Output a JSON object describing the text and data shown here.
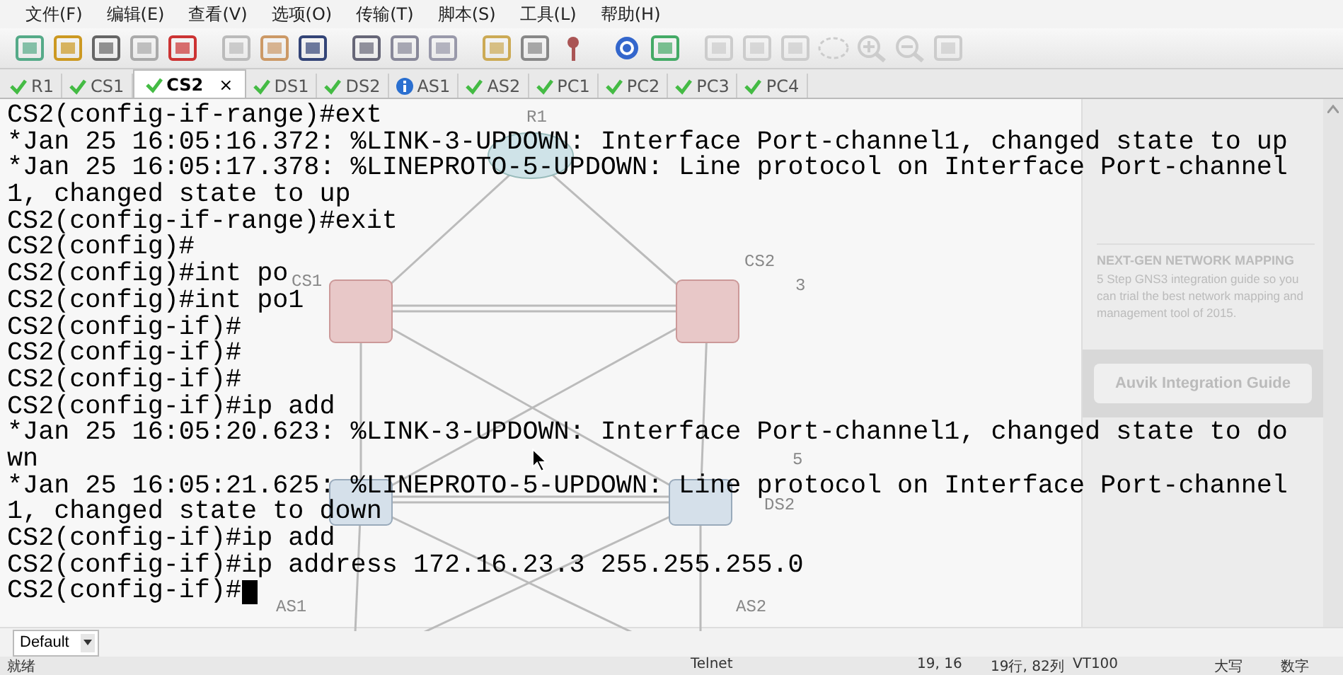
{
  "menu": [
    "文件(F)",
    "编辑(E)",
    "查看(V)",
    "选项(O)",
    "传输(T)",
    "脚本(S)",
    "工具(L)",
    "帮助(H)"
  ],
  "tabs": [
    {
      "label": "R1",
      "kind": "ok",
      "selected": false
    },
    {
      "label": "CS1",
      "kind": "ok",
      "selected": false
    },
    {
      "label": "CS2",
      "kind": "ok",
      "selected": true,
      "close": "×"
    },
    {
      "label": "DS1",
      "kind": "ok",
      "selected": false
    },
    {
      "label": "DS2",
      "kind": "ok",
      "selected": false
    },
    {
      "label": "AS1",
      "kind": "info",
      "selected": false
    },
    {
      "label": "AS2",
      "kind": "ok",
      "selected": false
    },
    {
      "label": "PC1",
      "kind": "ok",
      "selected": false
    },
    {
      "label": "PC2",
      "kind": "ok",
      "selected": false
    },
    {
      "label": "PC3",
      "kind": "ok",
      "selected": false
    },
    {
      "label": "PC4",
      "kind": "ok",
      "selected": false
    }
  ],
  "topology": {
    "nodes": [
      "R1",
      "CS1",
      "CS2",
      "DS2",
      "AS1",
      "AS2"
    ],
    "numbers": [
      "3",
      "5"
    ]
  },
  "terminal": {
    "lines": [
      "CS2(config-if-range)#ext",
      "*Jan 25 16:05:16.372: %LINK-3-UPDOWN: Interface Port-channel1, changed state to up",
      "*Jan 25 16:05:17.378: %LINEPROTO-5-UPDOWN: Line protocol on Interface Port-channel",
      "1, changed state to up",
      "CS2(config-if-range)#exit",
      "CS2(config)#",
      "CS2(config)#int po",
      "CS2(config)#int po1",
      "CS2(config-if)#",
      "CS2(config-if)#",
      "CS2(config-if)#",
      "CS2(config-if)#ip add",
      "*Jan 25 16:05:20.623: %LINK-3-UPDOWN: Interface Port-channel1, changed state to do",
      "wn",
      "*Jan 25 16:05:21.625: %LINEPROTO-5-UPDOWN: Line protocol on Interface Port-channel",
      "1, changed state to down",
      "CS2(config-if)#ip add",
      "CS2(config-if)#ip address 172.16.23.3 255.255.255.0",
      "CS2(config-if)#"
    ],
    "cursor": true
  },
  "side_panel": {
    "heading": "NEXT-GEN NETWORK MAPPING",
    "text": "5 Step GNS3 integration guide so you can trial the best network mapping and management tool of 2015.",
    "button": "Auvik Integration Guide"
  },
  "session_select": {
    "value": "Default"
  },
  "status_bar": [
    "就绪",
    "Telnet",
    "19, 16",
    "19行, 82列",
    "VT100",
    "大写",
    "数字"
  ]
}
